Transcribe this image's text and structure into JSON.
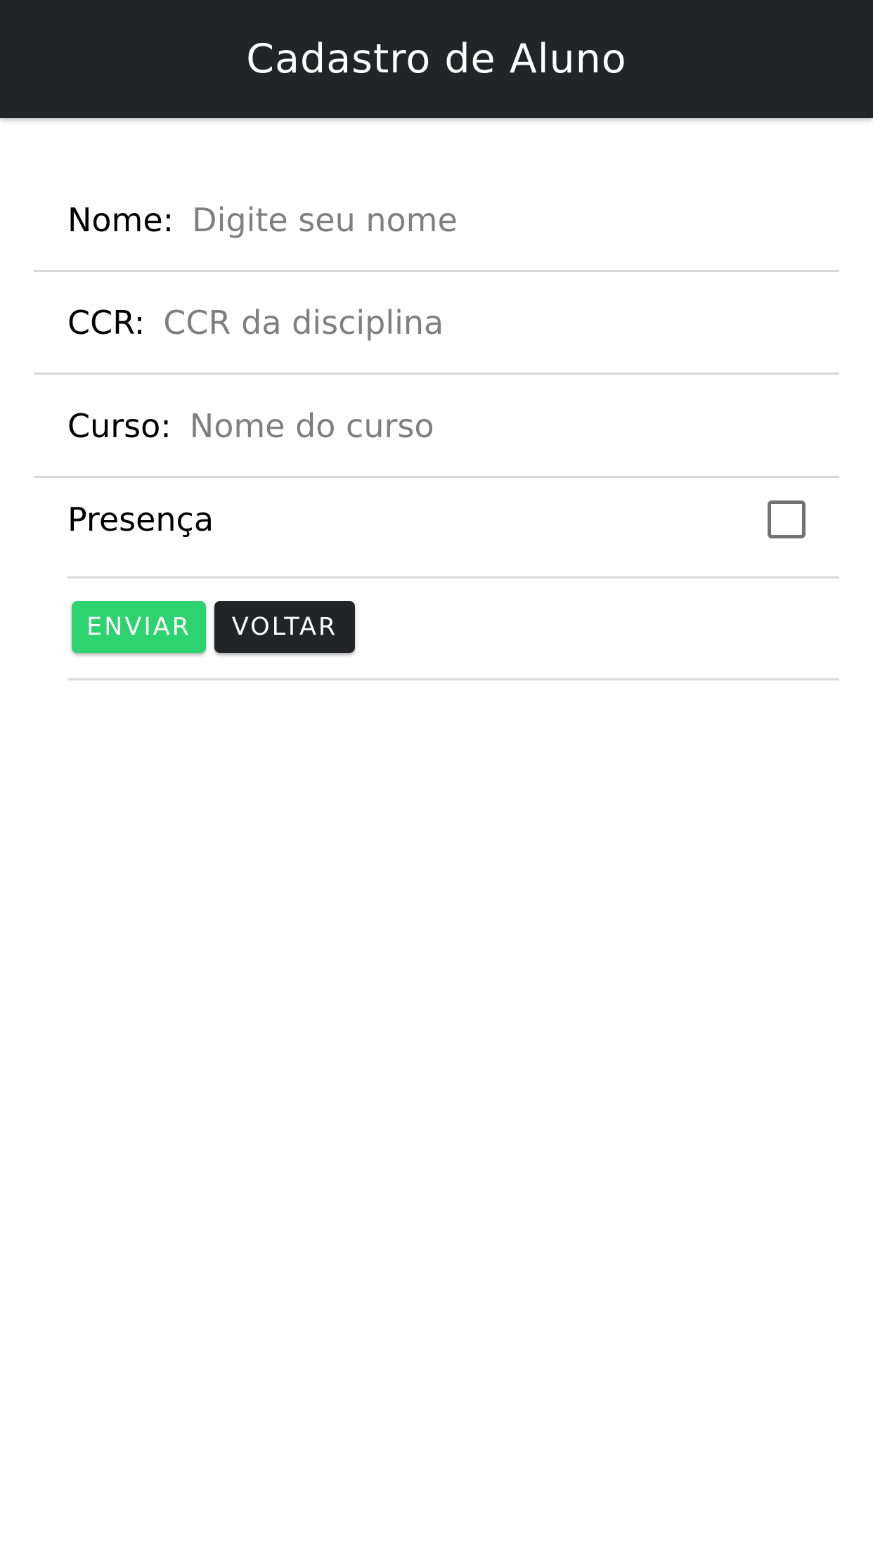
{
  "header": {
    "title": "Cadastro de Aluno"
  },
  "form": {
    "fields": [
      {
        "label": "Nome:",
        "value": "",
        "placeholder": "Digite seu nome"
      },
      {
        "label": "CCR:",
        "value": "",
        "placeholder": "CCR da disciplina"
      },
      {
        "label": "Curso:",
        "value": "",
        "placeholder": "Nome do curso"
      }
    ],
    "presence": {
      "label": "Presença",
      "checked": false
    },
    "buttons": {
      "send_label": "ENVIAR",
      "back_label": "VOLTAR"
    }
  },
  "colors": {
    "header_bg": "#222428",
    "send_button": "#2dd36f",
    "back_button": "#222428",
    "placeholder": "#7f7f7f",
    "divider": "#d9d9d9"
  }
}
